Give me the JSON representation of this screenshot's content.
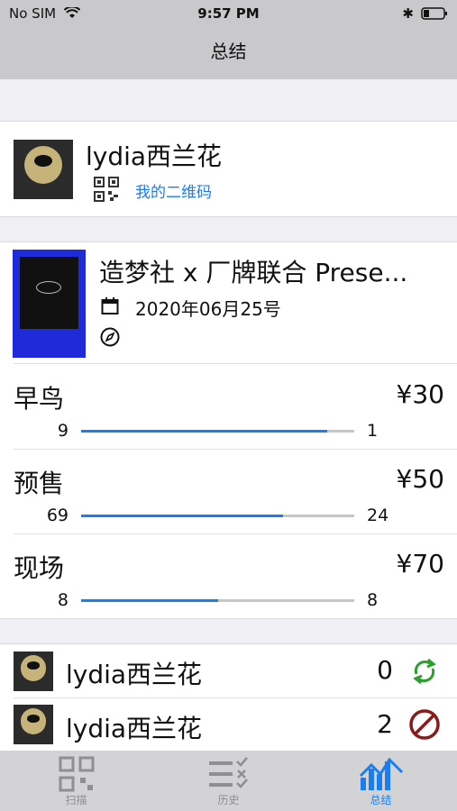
{
  "status": {
    "carrier": "No SIM",
    "time": "9:57 PM"
  },
  "nav": {
    "title": "总结"
  },
  "profile": {
    "name": "lydia西兰花",
    "qr_link": "我的二维码"
  },
  "event": {
    "title": "造梦社 x 厂牌联合 Prese...",
    "date": "2020年06月25号"
  },
  "tickets": [
    {
      "name": "早鸟",
      "price": "¥30",
      "sold": "9",
      "left": "1",
      "fill": 0.9
    },
    {
      "name": "预售",
      "price": "¥50",
      "sold": "69",
      "left": "24",
      "fill": 0.74
    },
    {
      "name": "现场",
      "price": "¥70",
      "sold": "8",
      "left": "8",
      "fill": 0.5
    }
  ],
  "staff": [
    {
      "name": "lydia西兰花",
      "count": "0",
      "icon": "refresh-icon"
    },
    {
      "name": "lydia西兰花",
      "count": "2",
      "icon": "prohibited-icon"
    }
  ],
  "tabs": [
    {
      "label": "扫描"
    },
    {
      "label": "历史"
    },
    {
      "label": "总结"
    }
  ],
  "colors": {
    "accent": "#1a7ef0",
    "green": "#2ca02c",
    "red": "#8b1a1a"
  }
}
